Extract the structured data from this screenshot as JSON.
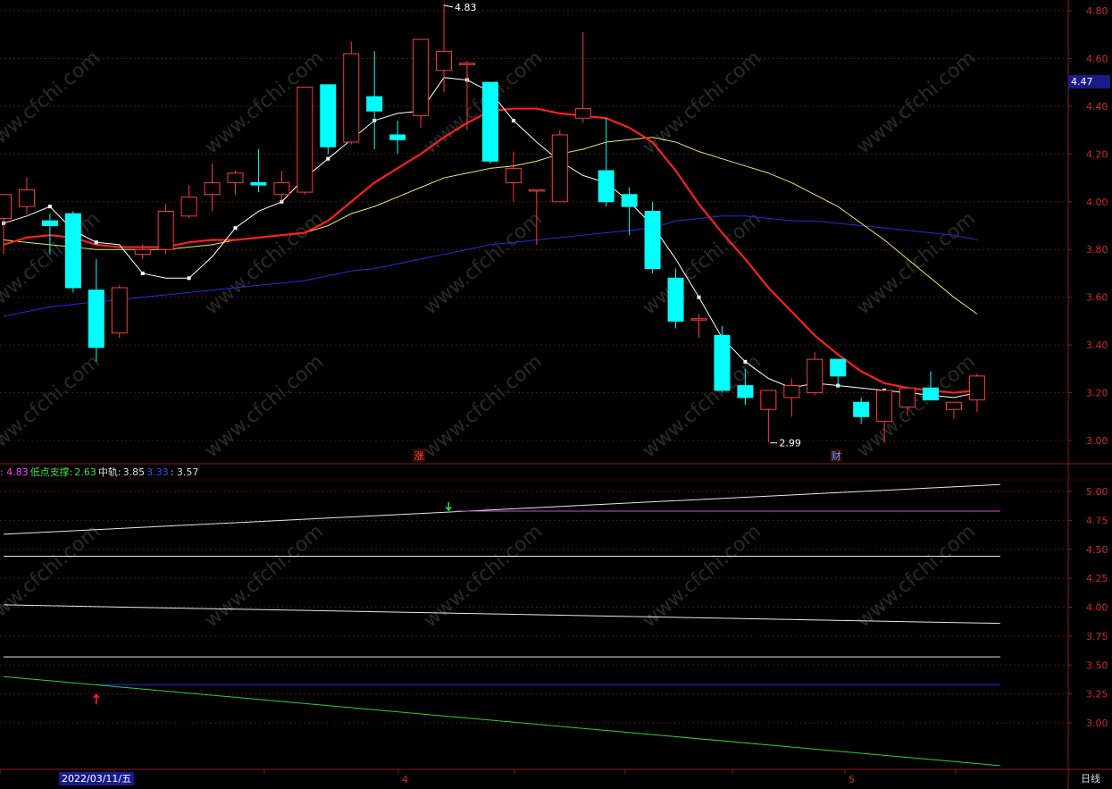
{
  "colors": {
    "background": "#000000",
    "frame": "#8b1a1a",
    "up_candle": "#ff3b3b",
    "down_candle": "#00ffff",
    "ma5": "#ffffff",
    "ma10": "#ff2020",
    "ma20": "#e8e860",
    "ma60": "#2030e0",
    "axis_text": "#cc2a2a"
  },
  "watermark": "www.cfchi.com",
  "main_chart": {
    "y_ticks": [
      "4.80",
      "4.60",
      "4.40",
      "4.20",
      "4.00",
      "3.80",
      "3.60",
      "3.40",
      "3.20",
      "3.00"
    ],
    "current_price_label": "4.47",
    "high_annotation": "4.83",
    "low_annotation": "2.99",
    "markers": [
      {
        "text": "涨",
        "color": "#ff4040"
      },
      {
        "text": "财",
        "color": "#6aa0ff"
      }
    ]
  },
  "sub_chart": {
    "header": [
      {
        "text": ": 4.83",
        "color": "#ff40ff"
      },
      {
        "text": "低点支撑:",
        "color": "#40e040"
      },
      {
        "text": "2.63",
        "color": "#40e040"
      },
      {
        "text": "中轨:",
        "color": "#e0e0e0"
      },
      {
        "text": "3.85",
        "color": "#e0e0e0"
      },
      {
        "text": "3.33",
        "color": "#3050ff"
      },
      {
        "text": ": 3.57",
        "color": "#e0e0e0"
      }
    ],
    "y_ticks": [
      "5.00",
      "4.75",
      "4.50",
      "4.25",
      "4.00",
      "3.75",
      "3.50",
      "3.25",
      "3.00"
    ]
  },
  "time_axis": {
    "date_label": "2022/03/11/五",
    "month_labels": [
      "4",
      "5"
    ],
    "period_label": "日线"
  },
  "chart_data": {
    "type": "candlestick",
    "ylim": [
      2.93,
      4.85
    ],
    "candles": [
      {
        "o": 3.93,
        "h": 4.01,
        "l": 3.78,
        "c": 4.03
      },
      {
        "o": 3.98,
        "h": 4.1,
        "l": 3.95,
        "c": 4.05
      },
      {
        "o": 3.92,
        "h": 3.95,
        "l": 3.78,
        "c": 3.9
      },
      {
        "o": 3.95,
        "h": 3.96,
        "l": 3.62,
        "c": 3.64
      },
      {
        "o": 3.63,
        "h": 3.76,
        "l": 3.33,
        "c": 3.39
      },
      {
        "o": 3.45,
        "h": 3.65,
        "l": 3.43,
        "c": 3.64
      },
      {
        "o": 3.78,
        "h": 3.82,
        "l": 3.76,
        "c": 3.8
      },
      {
        "o": 3.8,
        "h": 3.99,
        "l": 3.78,
        "c": 3.96
      },
      {
        "o": 3.94,
        "h": 4.07,
        "l": 3.93,
        "c": 4.02
      },
      {
        "o": 4.03,
        "h": 4.16,
        "l": 3.96,
        "c": 4.08
      },
      {
        "o": 4.08,
        "h": 4.13,
        "l": 4.03,
        "c": 4.12
      },
      {
        "o": 4.08,
        "h": 4.22,
        "l": 4.04,
        "c": 4.07
      },
      {
        "o": 4.03,
        "h": 4.13,
        "l": 4.0,
        "c": 4.08
      },
      {
        "o": 4.04,
        "h": 4.48,
        "l": 4.03,
        "c": 4.48
      },
      {
        "o": 4.49,
        "h": 4.49,
        "l": 4.2,
        "c": 4.23
      },
      {
        "o": 4.25,
        "h": 4.67,
        "l": 4.24,
        "c": 4.62
      },
      {
        "o": 4.44,
        "h": 4.63,
        "l": 4.22,
        "c": 4.38
      },
      {
        "o": 4.28,
        "h": 4.34,
        "l": 4.2,
        "c": 4.26
      },
      {
        "o": 4.36,
        "h": 4.5,
        "l": 4.31,
        "c": 4.68
      },
      {
        "o": 4.55,
        "h": 4.83,
        "l": 4.46,
        "c": 4.63
      },
      {
        "o": 4.58,
        "h": 4.59,
        "l": 4.3,
        "c": 4.58
      },
      {
        "o": 4.5,
        "h": 4.5,
        "l": 4.16,
        "c": 4.17
      },
      {
        "o": 4.08,
        "h": 4.21,
        "l": 4.0,
        "c": 4.14
      },
      {
        "o": 4.05,
        "h": 4.05,
        "l": 3.82,
        "c": 4.05
      },
      {
        "o": 4.0,
        "h": 4.3,
        "l": 4.0,
        "c": 4.28
      },
      {
        "o": 4.35,
        "h": 4.71,
        "l": 4.33,
        "c": 4.39
      },
      {
        "o": 4.13,
        "h": 4.35,
        "l": 3.98,
        "c": 4.0
      },
      {
        "o": 4.03,
        "h": 4.06,
        "l": 3.86,
        "c": 3.98
      },
      {
        "o": 3.96,
        "h": 4.0,
        "l": 3.7,
        "c": 3.72
      },
      {
        "o": 3.68,
        "h": 3.72,
        "l": 3.47,
        "c": 3.5
      },
      {
        "o": 3.51,
        "h": 3.53,
        "l": 3.43,
        "c": 3.51
      },
      {
        "o": 3.44,
        "h": 3.48,
        "l": 3.2,
        "c": 3.21
      },
      {
        "o": 3.23,
        "h": 3.3,
        "l": 3.15,
        "c": 3.18
      },
      {
        "o": 3.13,
        "h": 3.21,
        "l": 2.99,
        "c": 3.21
      },
      {
        "o": 3.18,
        "h": 3.26,
        "l": 3.1,
        "c": 3.23
      },
      {
        "o": 3.2,
        "h": 3.37,
        "l": 3.19,
        "c": 3.34
      },
      {
        "o": 3.34,
        "h": 3.34,
        "l": 3.22,
        "c": 3.27
      },
      {
        "o": 3.16,
        "h": 3.18,
        "l": 3.07,
        "c": 3.1
      },
      {
        "o": 3.08,
        "h": 3.2,
        "l": 2.99,
        "c": 3.21
      },
      {
        "o": 3.14,
        "h": 3.22,
        "l": 3.1,
        "c": 3.22
      },
      {
        "o": 3.22,
        "h": 3.29,
        "l": 3.17,
        "c": 3.17
      },
      {
        "o": 3.13,
        "h": 3.16,
        "l": 3.09,
        "c": 3.16
      },
      {
        "o": 3.17,
        "h": 3.28,
        "l": 3.12,
        "c": 3.27
      }
    ],
    "ma5_points": [
      3.91,
      3.94,
      3.98,
      3.88,
      3.83,
      3.82,
      3.7,
      3.68,
      3.68,
      3.77,
      3.89,
      3.96,
      4.0,
      4.1,
      4.18,
      4.26,
      4.34,
      4.37,
      4.38,
      4.52,
      4.51,
      4.46,
      4.34,
      4.25,
      4.17,
      4.11,
      4.08,
      4.0,
      3.9,
      3.76,
      3.6,
      3.43,
      3.33,
      3.26,
      3.22,
      3.24,
      3.23,
      3.22,
      3.21,
      3.2,
      3.19,
      3.18,
      3.2
    ],
    "ma10_points": [
      3.82,
      3.85,
      3.86,
      3.85,
      3.82,
      3.81,
      3.81,
      3.81,
      3.83,
      3.84,
      3.84,
      3.85,
      3.86,
      3.87,
      3.92,
      4.0,
      4.08,
      4.14,
      4.2,
      4.27,
      4.33,
      4.38,
      4.39,
      4.39,
      4.37,
      4.36,
      4.35,
      4.31,
      4.25,
      4.13,
      3.99,
      3.87,
      3.76,
      3.64,
      3.54,
      3.44,
      3.36,
      3.29,
      3.24,
      3.22,
      3.21,
      3.2,
      3.21
    ],
    "ma20_points": [
      3.84,
      3.83,
      3.82,
      3.81,
      3.8,
      3.8,
      3.8,
      3.8,
      3.81,
      3.82,
      3.84,
      3.85,
      3.86,
      3.87,
      3.9,
      3.95,
      3.98,
      4.02,
      4.06,
      4.1,
      4.12,
      4.14,
      4.15,
      4.17,
      4.2,
      4.22,
      4.25,
      4.26,
      4.27,
      4.25,
      4.21,
      4.18,
      4.15,
      4.12,
      4.08,
      4.03,
      3.98,
      3.91,
      3.84,
      3.76,
      3.68,
      3.6,
      3.53
    ],
    "ma60_points": [
      3.52,
      3.54,
      3.56,
      3.57,
      3.58,
      3.59,
      3.6,
      3.61,
      3.62,
      3.63,
      3.64,
      3.65,
      3.66,
      3.67,
      3.69,
      3.71,
      3.72,
      3.74,
      3.76,
      3.78,
      3.8,
      3.82,
      3.83,
      3.84,
      3.85,
      3.86,
      3.87,
      3.88,
      3.89,
      3.92,
      3.93,
      3.94,
      3.94,
      3.93,
      3.92,
      3.92,
      3.91,
      3.9,
      3.89,
      3.88,
      3.87,
      3.86,
      3.84
    ],
    "sub_lines": {
      "ylim": [
        2.62,
        5.12
      ],
      "upper": [
        [
          0,
          4.63
        ],
        [
          43,
          5.06
        ]
      ],
      "high_line": [
        [
          19.5,
          4.83
        ],
        [
          43,
          4.83
        ]
      ],
      "level_445": [
        [
          0,
          4.44
        ],
        [
          43,
          4.44
        ]
      ],
      "mid": [
        [
          0,
          4.02
        ],
        [
          43,
          3.86
        ]
      ],
      "level_357": [
        [
          0,
          3.57
        ],
        [
          43,
          3.57
        ]
      ],
      "low_blue": [
        [
          4,
          3.33
        ],
        [
          43,
          3.33
        ]
      ],
      "support_green": [
        [
          0,
          3.4
        ],
        [
          43,
          2.63
        ]
      ]
    }
  }
}
